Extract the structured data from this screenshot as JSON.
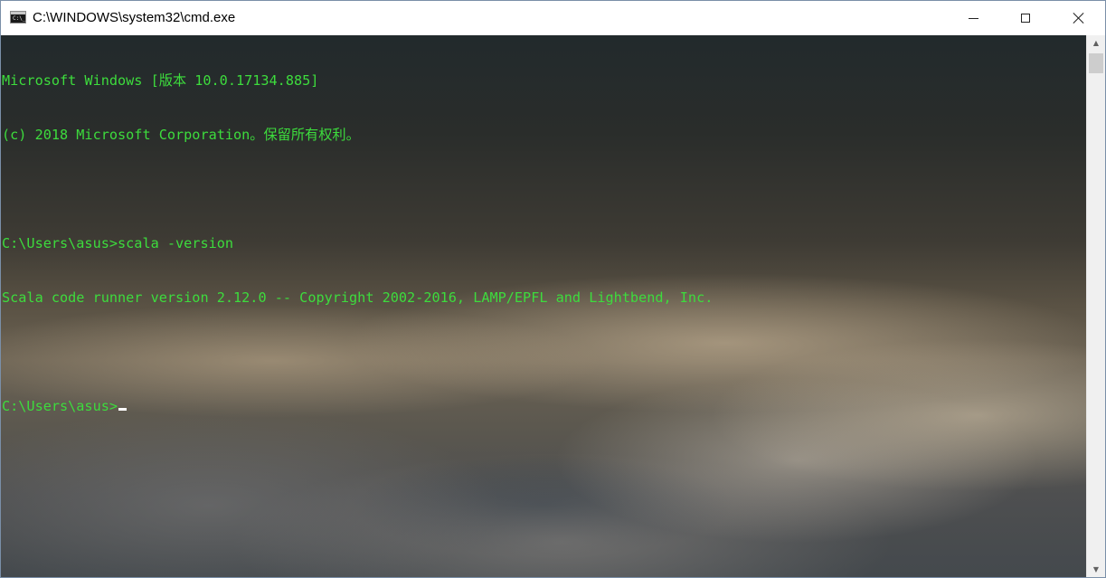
{
  "window": {
    "title": "C:\\WINDOWS\\system32\\cmd.exe",
    "icon": "cmd-console-icon",
    "icon_prompt": "C:\\_"
  },
  "caption_buttons": {
    "minimize_icon": "minimize-icon",
    "maximize_icon": "maximize-icon",
    "close_icon": "close-icon"
  },
  "console": {
    "text_color": "#3ddc3d",
    "lines": [
      "Microsoft Windows [版本 10.0.17134.885]",
      "(c) 2018 Microsoft Corporation。保留所有权利。",
      "",
      "C:\\Users\\asus>scala -version",
      "Scala code runner version 2.12.0 -- Copyright 2002-2016, LAMP/EPFL and Lightbend, Inc.",
      "",
      "C:\\Users\\asus>"
    ]
  },
  "scrollbar": {
    "up_arrow": "▲",
    "down_arrow": "▼"
  }
}
